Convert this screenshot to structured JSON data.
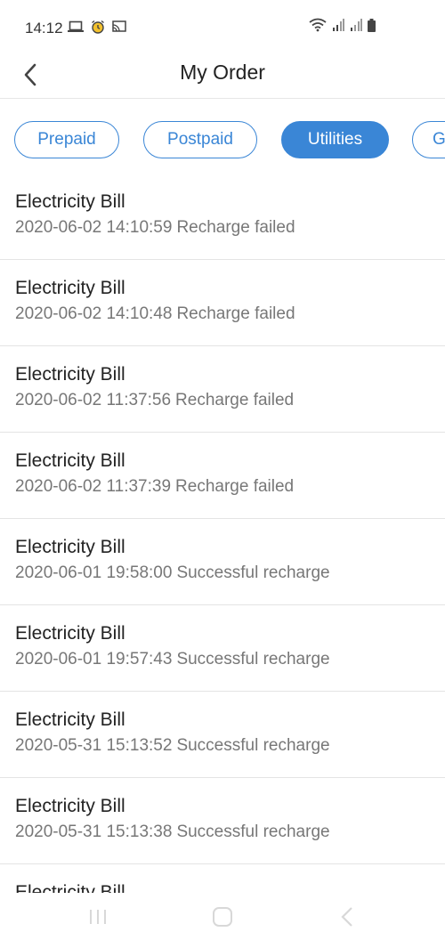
{
  "status_bar": {
    "time": "14:12",
    "left_icons": [
      "laptop-icon",
      "alarm-icon",
      "cast-icon"
    ],
    "right_icons": [
      "wifi-icon",
      "signal-icon",
      "signal-icon",
      "battery-icon"
    ]
  },
  "header": {
    "back_icon": "chevron-left-icon",
    "title": "My Order"
  },
  "tabs": [
    {
      "label": "Prepaid",
      "active": false
    },
    {
      "label": "Postpaid",
      "active": false
    },
    {
      "label": "Utilities",
      "active": true
    },
    {
      "label": "G",
      "active": false
    }
  ],
  "orders": [
    {
      "title": "Electricity Bill",
      "datetime": "2020-06-02 14:10:59",
      "status": "Recharge failed"
    },
    {
      "title": "Electricity Bill",
      "datetime": "2020-06-02 14:10:48",
      "status": "Recharge failed"
    },
    {
      "title": "Electricity Bill",
      "datetime": "2020-06-02 11:37:56",
      "status": "Recharge failed"
    },
    {
      "title": "Electricity Bill",
      "datetime": "2020-06-02 11:37:39",
      "status": "Recharge failed"
    },
    {
      "title": "Electricity Bill",
      "datetime": "2020-06-01 19:58:00",
      "status": "Successful recharge"
    },
    {
      "title": "Electricity Bill",
      "datetime": "2020-06-01 19:57:43",
      "status": "Successful recharge"
    },
    {
      "title": "Electricity Bill",
      "datetime": "2020-05-31 15:13:52",
      "status": "Successful recharge"
    },
    {
      "title": "Electricity Bill",
      "datetime": "2020-05-31 15:13:38",
      "status": "Successful recharge"
    },
    {
      "title": "Electricity Bill",
      "datetime": "",
      "status": ""
    }
  ],
  "nav_bar": {
    "icons": [
      "recent-apps-icon",
      "home-icon",
      "back-icon"
    ]
  },
  "colors": {
    "accent": "#3a86d6",
    "text_primary": "#222222",
    "text_secondary": "#777777",
    "divider": "#e4e4e4"
  }
}
